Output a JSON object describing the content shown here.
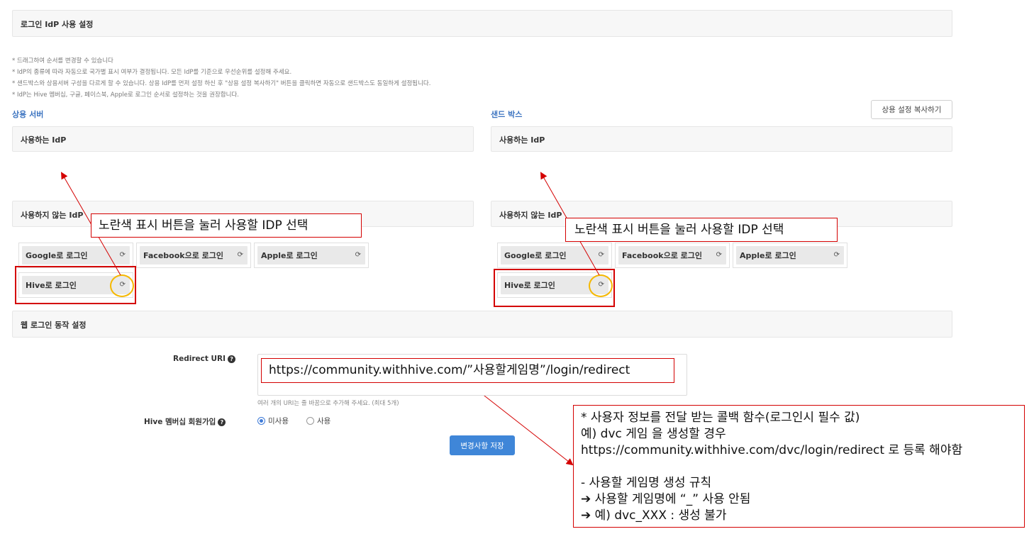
{
  "idp_settings": {
    "title": "로그인 IdP 사용 설정"
  },
  "notes": [
    "* 드래그하여 순서를 변경할 수 있습니다",
    "* IdP의 종류에 따라 자동으로 국가별 표시 여부가 결정됩니다. 모든 IdP를 기준으로 우선순위를 설정해 주세요.",
    "* 샌드박스와 상용서버 구성을 다르게 할 수 있습니다. 상용 IdP를 먼저 설정 하신 후 \"상용 설정 복사하기\" 버튼을 클릭하면 자동으로 샌드박스도 동일하게 설정됩니다.",
    "* IdP는 Hive 멤버십, 구글, 페이스북, Apple로 로그인 순서로 설정하는 것을 권장합니다."
  ],
  "copy_button": "상용 설정 복사하기",
  "production": {
    "label": "상용 서버",
    "used_idp_title": "사용하는 IdP",
    "unused_idp_title": "사용하지 않는 IdP",
    "idps": [
      "Google로 로그인",
      "Facebook으로 로그인",
      "Apple로 로그인",
      "Hive로 로그인"
    ]
  },
  "sandbox": {
    "label": "샌드 박스",
    "used_idp_title": "사용하는 IdP",
    "unused_idp_title": "사용하지 않는 IdP",
    "idps": [
      "Google로 로그인",
      "Facebook으로 로그인",
      "Apple로 로그인",
      "Hive로 로그인"
    ]
  },
  "annotation": {
    "select_idp": "노란색 표시 버튼을 눌러 사용할 IDP 선택",
    "redirect_example": "https://community.withhive.com/”사용할게임명”/login/redirect",
    "note_lines": [
      "* 사용자 정보를 전달 받는 콜백 함수(로그인시 필수 값)",
      "예) dvc 게임 을 생성할 경우",
      "https://community.withhive.com/dvc/login/redirect 로 등록 해야함",
      "",
      "- 사용할 게임명 생성 규칙",
      "➔ 사용할 게임명에 “_” 사용 안됨",
      "➔ 예) dvc_XXX : 생성 불가"
    ]
  },
  "web_login": {
    "title": "웹 로그인 동작 설정",
    "redirect_label": "Redirect URI",
    "redirect_hint": "여러 개의 URI는 줄 바꿈으로 추가해 주세요. (최대 5개)",
    "membership_label": "Hive 멤버십 회원가입",
    "option_unused": "미사용",
    "option_used": "사용",
    "selected": "미사용"
  },
  "save_button": "변경사항 저장",
  "colors": {
    "accent_blue": "#3f86d8",
    "section_blue": "#3b73c0",
    "annotation_red": "#d40000",
    "highlight_yellow": "#f5b800"
  },
  "icons": {
    "refresh": "refresh-icon",
    "help": "question-circle-icon"
  }
}
